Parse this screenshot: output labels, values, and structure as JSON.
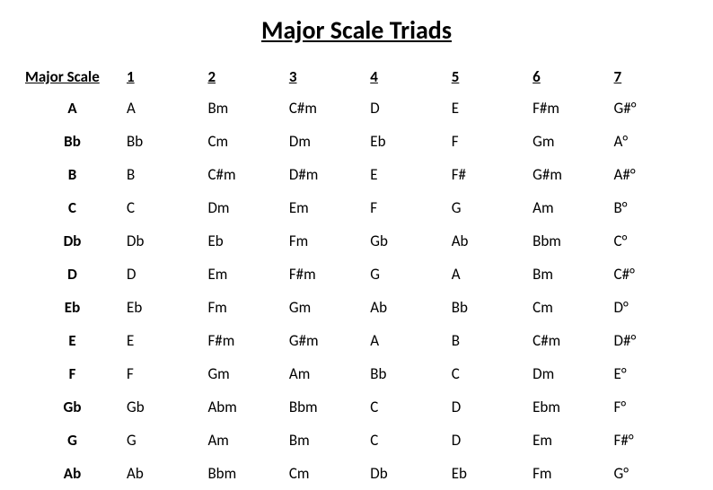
{
  "title": "Major Scale Triads",
  "headers": {
    "col0": "Major Scale",
    "col1": "1",
    "col2": "2",
    "col3": "3",
    "col4": "4",
    "col5": "5",
    "col6": "6",
    "col7": "7"
  },
  "rows": [
    {
      "scale": "A",
      "c1": "A",
      "c2": "Bm",
      "c3": "C#m",
      "c4": "D",
      "c5": "E",
      "c6": "F#m",
      "c7": "G#°"
    },
    {
      "scale": "Bb",
      "c1": "Bb",
      "c2": "Cm",
      "c3": "Dm",
      "c4": "Eb",
      "c5": "F",
      "c6": "Gm",
      "c7": "A°"
    },
    {
      "scale": "B",
      "c1": "B",
      "c2": "C#m",
      "c3": "D#m",
      "c4": "E",
      "c5": "F#",
      "c6": "G#m",
      "c7": "A#°"
    },
    {
      "scale": "C",
      "c1": "C",
      "c2": "Dm",
      "c3": "Em",
      "c4": "F",
      "c5": "G",
      "c6": "Am",
      "c7": "B°"
    },
    {
      "scale": "Db",
      "c1": "Db",
      "c2": "Eb",
      "c3": "Fm",
      "c4": "Gb",
      "c5": "Ab",
      "c6": "Bbm",
      "c7": "C°"
    },
    {
      "scale": "D",
      "c1": "D",
      "c2": "Em",
      "c3": "F#m",
      "c4": "G",
      "c5": "A",
      "c6": "Bm",
      "c7": "C#°"
    },
    {
      "scale": "Eb",
      "c1": "Eb",
      "c2": "Fm",
      "c3": "Gm",
      "c4": "Ab",
      "c5": "Bb",
      "c6": "Cm",
      "c7": "D°"
    },
    {
      "scale": "E",
      "c1": "E",
      "c2": "F#m",
      "c3": "G#m",
      "c4": "A",
      "c5": "B",
      "c6": "C#m",
      "c7": "D#°"
    },
    {
      "scale": "F",
      "c1": "F",
      "c2": "Gm",
      "c3": "Am",
      "c4": "Bb",
      "c5": "C",
      "c6": "Dm",
      "c7": "E°"
    },
    {
      "scale": "Gb",
      "c1": "Gb",
      "c2": "Abm",
      "c3": "Bbm",
      "c4": "C",
      "c5": "D",
      "c6": "Ebm",
      "c7": "F°"
    },
    {
      "scale": "G",
      "c1": "G",
      "c2": "Am",
      "c3": "Bm",
      "c4": "C",
      "c5": "D",
      "c6": "Em",
      "c7": "F#°"
    },
    {
      "scale": "Ab",
      "c1": "Ab",
      "c2": "Bbm",
      "c3": "Cm",
      "c4": "Db",
      "c5": "Eb",
      "c6": "Fm",
      "c7": "G°"
    }
  ]
}
